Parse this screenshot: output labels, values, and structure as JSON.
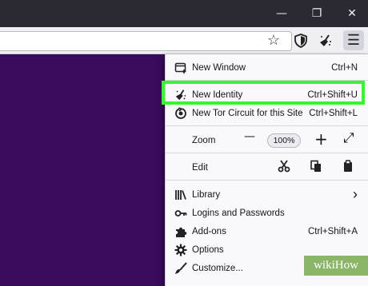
{
  "window": {
    "minimize_glyph": "—",
    "restore_glyph": "❐",
    "close_glyph": "✕"
  },
  "toolbar": {
    "star_icon": "☆",
    "menu_icon": "☰"
  },
  "menu": {
    "new_window": {
      "label": "New Window",
      "shortcut": "Ctrl+N"
    },
    "new_identity": {
      "label": "New Identity",
      "shortcut": "Ctrl+Shift+U"
    },
    "new_circuit": {
      "label": "New Tor Circuit for this Site",
      "shortcut": "Ctrl+Shift+L"
    },
    "zoom": {
      "label": "Zoom",
      "minus": "—",
      "value": "100%",
      "plus": "+",
      "fullscreen": "⤢"
    },
    "edit": {
      "label": "Edit"
    },
    "library": {
      "label": "Library",
      "arrow": "›"
    },
    "logins": {
      "label": "Logins and Passwords"
    },
    "addons": {
      "label": "Add-ons",
      "shortcut": "Ctrl+Shift+A"
    },
    "options": {
      "label": "Options"
    },
    "customize": {
      "label": "Customize..."
    }
  },
  "colors": {
    "page_bg": "#3a0a5c",
    "highlight": "#3ef038"
  },
  "watermark": {
    "text": "wikiHow"
  }
}
